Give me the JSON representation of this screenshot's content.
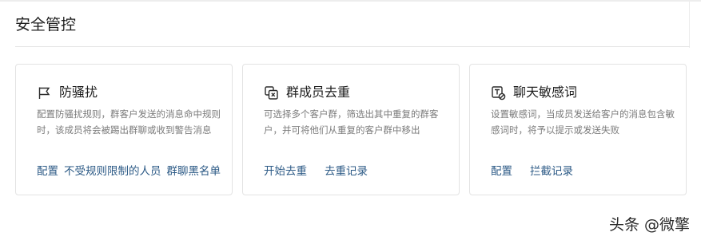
{
  "page": {
    "section_title": "安全管控"
  },
  "cards": [
    {
      "icon": "flag-icon",
      "title": "防骚扰",
      "description": "配置防骚扰规则，群客户发送的消息命中规则时，该成员将会被踢出群聊或收到警告消息",
      "links": [
        "配置",
        "不受规则限制的人员",
        "群聊黑名单"
      ]
    },
    {
      "icon": "group-dedupe-icon",
      "title": "群成员去重",
      "description": "可选择多个客户群，筛选出其中重复的群客户，并可将他们从重复的客户群中移出",
      "links": [
        "开始去重",
        "去重记录"
      ]
    },
    {
      "icon": "sensitive-text-icon",
      "title": "聊天敏感词",
      "description": "设置敏感词，当成员发送给客户的消息包含敏感词时，将予以提示或发送失败",
      "links": [
        "配置",
        "拦截记录"
      ]
    }
  ],
  "watermark": {
    "text": "头条 @微擎"
  },
  "colors": {
    "link": "#2c5a86",
    "description": "#7b7b7b",
    "title": "#1d1d1d",
    "border": "#e3e3e3"
  }
}
